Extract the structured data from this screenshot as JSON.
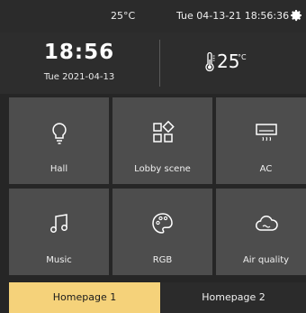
{
  "status_bar": {
    "temperature": "25°C",
    "datetime": "Tue 04-13-21 18:56:36",
    "settings_icon": "gear-icon"
  },
  "header": {
    "time": "18:56",
    "date": "Tue 2021-04-13",
    "temperature_value": "25",
    "temperature_unit": "°C",
    "thermometer_icon": "thermometer-icon"
  },
  "tiles": [
    {
      "label": "Hall",
      "icon": "bulb-icon"
    },
    {
      "label": "Lobby scene",
      "icon": "scene-icon"
    },
    {
      "label": "AC",
      "icon": "ac-icon"
    },
    {
      "label": "Music",
      "icon": "music-icon"
    },
    {
      "label": "RGB",
      "icon": "palette-icon"
    },
    {
      "label": "Air quality",
      "icon": "cloud-icon"
    }
  ],
  "tabs": [
    {
      "label": "Homepage 1",
      "active": true
    },
    {
      "label": "Homepage 2",
      "active": false
    }
  ],
  "colors": {
    "background": "#262626",
    "tile": "#4d4d4d",
    "active_tab": "#f5d27a"
  }
}
